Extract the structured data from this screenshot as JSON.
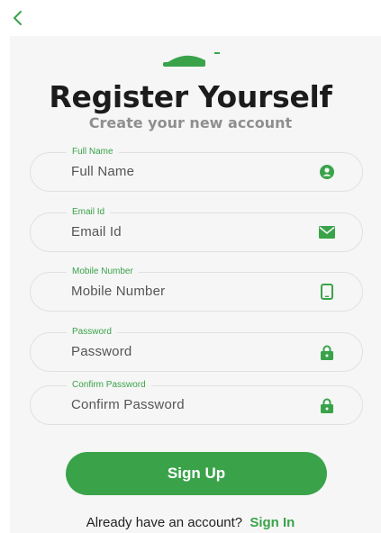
{
  "header": {
    "back_icon": "chevron-left-icon"
  },
  "brand": {
    "logo_icon": "arc-logo-icon",
    "accent_color": "#3aa34a"
  },
  "title": "Register Yourself",
  "subtitle": "Create your new account",
  "form": {
    "fields": [
      {
        "legend": "Full Name",
        "placeholder": "Full Name",
        "icon": "user-icon"
      },
      {
        "legend": "Email Id",
        "placeholder": "Email Id",
        "icon": "envelope-icon"
      },
      {
        "legend": "Mobile Number",
        "placeholder": "Mobile Number",
        "icon": "mobile-icon"
      },
      {
        "legend": "Password",
        "placeholder": "Password",
        "icon": "lock-icon"
      },
      {
        "legend": "Confirm Password",
        "placeholder": "Confirm Password",
        "icon": "lock-icon"
      }
    ],
    "submit_label": "Sign Up"
  },
  "footer": {
    "prompt": "Already have an account?",
    "link_label": "Sign In"
  }
}
